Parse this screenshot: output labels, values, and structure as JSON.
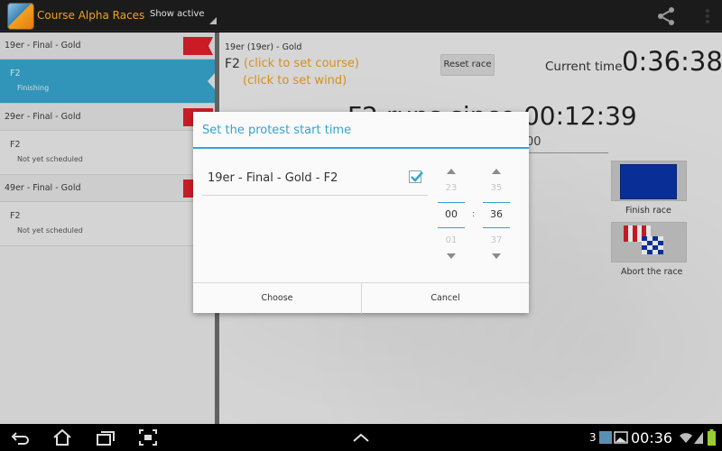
{
  "actionbar": {
    "app_title": "Course Alpha Races",
    "spinner_label": "Show active"
  },
  "race_list": {
    "groups": [
      {
        "label": "19er - Final - Gold",
        "races": [
          {
            "name": "F2",
            "status": "Finishing",
            "selected": true
          }
        ]
      },
      {
        "label": "29er - Final - Gold",
        "races": [
          {
            "name": "F2",
            "status": "Not yet scheduled",
            "selected": false
          }
        ]
      },
      {
        "label": "49er - Final - Gold",
        "races": [
          {
            "name": "F2",
            "status": "Not yet scheduled",
            "selected": false
          }
        ]
      }
    ]
  },
  "race_detail": {
    "race_title": "19er (19er) - Gold",
    "race_name": "F2",
    "set_course": "(click to set course)",
    "set_wind": "(click to set wind)",
    "reset_button": "Reset race",
    "current_time_label": "Current time",
    "current_time": "0:36:38",
    "runs_since": "F2 runs since 00:12:39",
    "small_time": "00",
    "finish_label": "Finish race",
    "abort_label": "Abort the race"
  },
  "dialog": {
    "title": "Set the protest start time",
    "item_label": "19er - Final - Gold - F2",
    "item_checked": true,
    "hour": {
      "prev": "23",
      "current": "00",
      "next": "01"
    },
    "minute": {
      "prev": "35",
      "current": "36",
      "next": "37"
    },
    "separator": ":",
    "choose_button": "Choose",
    "cancel_button": "Cancel"
  },
  "statusbar": {
    "notification_count": "3",
    "time": "00:36"
  },
  "colors": {
    "accent": "#33a5d0",
    "orange": "#f0a020",
    "selected_row": "#36a6ce",
    "flag_red": "#e0202a",
    "finish_blue": "#0b35a8"
  }
}
